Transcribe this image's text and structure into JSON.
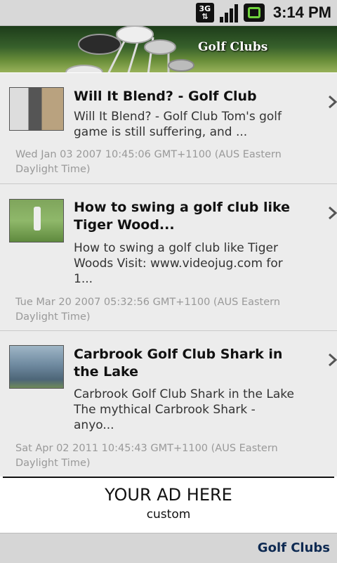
{
  "status_bar": {
    "network": "3G",
    "time": "3:14 PM",
    "icons": [
      "3g-icon",
      "signal-icon",
      "battery-icon"
    ]
  },
  "banner": {
    "title": "Golf Clubs"
  },
  "videos": [
    {
      "title": "Will It Blend? - Golf Club",
      "desc_lines": [
        "Will It Blend? - Golf Club Tom's golf",
        "game is still suffering, and ..."
      ],
      "date_lines": [
        "Wed Jan 03 2007 10:45:06 GMT+1100 (AUS Eastern",
        "Daylight Time)"
      ]
    },
    {
      "title_lines": [
        "How to swing a golf club like",
        "Tiger Wood..."
      ],
      "desc_lines": [
        "How to swing a golf club like Tiger",
        "Woods Visit: www.videojug.com for",
        "1..."
      ],
      "date_lines": [
        "Tue Mar 20 2007 05:32:56 GMT+1100 (AUS Eastern",
        "Daylight Time)"
      ]
    },
    {
      "title_lines": [
        "Carbrook Golf Club Shark in",
        "the Lake"
      ],
      "desc_lines": [
        "Carbrook Golf Club Shark in the Lake",
        "The mythical Carbrook Shark -",
        "anyo..."
      ],
      "date_lines": [
        "Sat Apr 02 2011 10:45:43 GMT+1100 (AUS Eastern",
        "Daylight Time)"
      ]
    }
  ],
  "ad": {
    "title": "YOUR AD HERE",
    "subtitle": "custom"
  },
  "footer": {
    "title": "Golf Clubs"
  },
  "colors": {
    "list_bg": "#ececec",
    "date_text": "#999999",
    "footer_title": "#0e2a52"
  }
}
